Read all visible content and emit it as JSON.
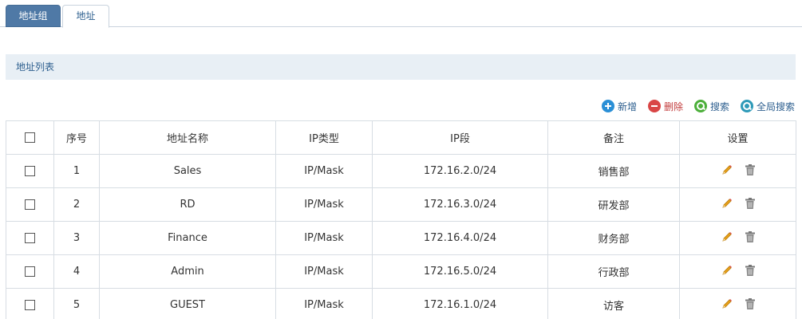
{
  "tabs": [
    {
      "label": "地址组",
      "active": false
    },
    {
      "label": "地址",
      "active": true
    }
  ],
  "section": {
    "title": "地址列表"
  },
  "toolbar": {
    "add_label": "新增",
    "delete_label": "删除",
    "search_label": "搜索",
    "global_search_label": "全局搜索"
  },
  "table": {
    "columns": [
      "",
      "序号",
      "地址名称",
      "IP类型",
      "IP段",
      "备注",
      "设置"
    ],
    "rows": [
      {
        "index": "1",
        "name": "Sales",
        "type": "IP/Mask",
        "range": "172.16.2.0/24",
        "note": "销售部"
      },
      {
        "index": "2",
        "name": "RD",
        "type": "IP/Mask",
        "range": "172.16.3.0/24",
        "note": "研发部"
      },
      {
        "index": "3",
        "name": "Finance",
        "type": "IP/Mask",
        "range": "172.16.4.0/24",
        "note": "财务部"
      },
      {
        "index": "4",
        "name": "Admin",
        "type": "IP/Mask",
        "range": "172.16.5.0/24",
        "note": "行政部"
      },
      {
        "index": "5",
        "name": "GUEST",
        "type": "IP/Mask",
        "range": "172.16.1.0/24",
        "note": "访客"
      }
    ]
  },
  "colors": {
    "tab_active_bg": "#4f79a6",
    "section_bg": "#e8eff5",
    "link_blue": "#2d5f8f",
    "add_icon": "#2a8fd6",
    "delete_icon": "#d94545",
    "search_icon": "#4caf3a",
    "global_search_icon": "#2e9ab8",
    "edit_icon": "#e8a21a",
    "trash_icon": "#777777"
  }
}
